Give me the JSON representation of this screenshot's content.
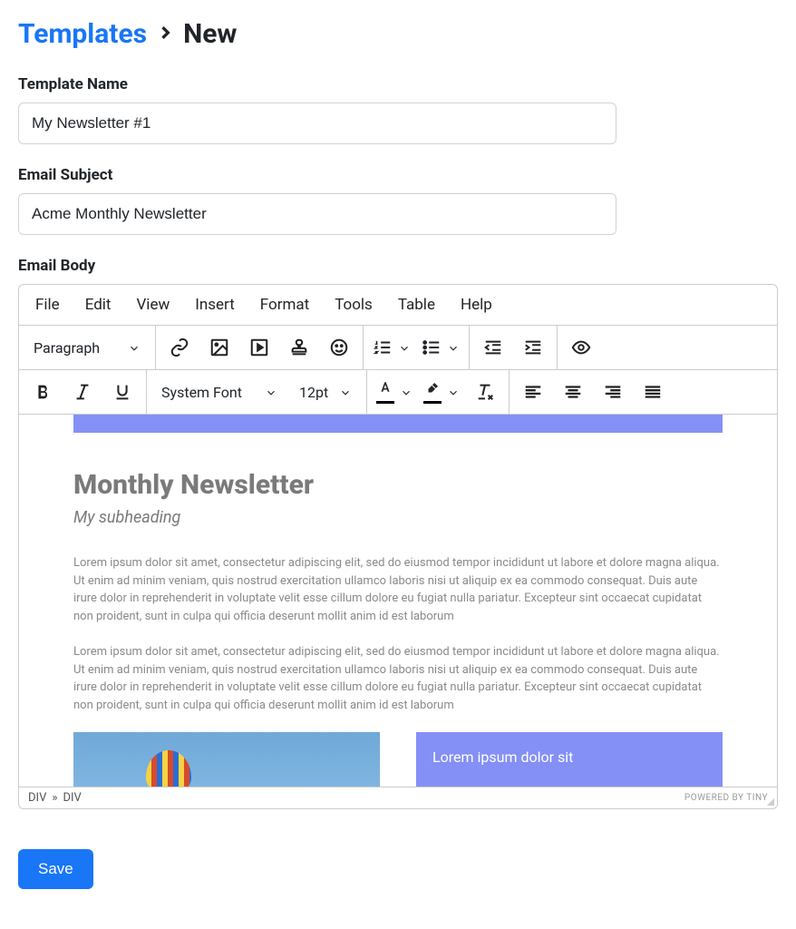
{
  "breadcrumb": {
    "root": "Templates",
    "current": "New"
  },
  "form": {
    "template_name_label": "Template Name",
    "template_name_value": "My Newsletter #1",
    "email_subject_label": "Email Subject",
    "email_subject_value": "Acme Monthly Newsletter",
    "email_body_label": "Email Body"
  },
  "editor": {
    "menus": [
      "File",
      "Edit",
      "View",
      "Insert",
      "Format",
      "Tools",
      "Table",
      "Help"
    ],
    "block_format": "Paragraph",
    "font_family": "System Font",
    "font_size": "12pt",
    "statusbar_path": [
      "DIV",
      "DIV"
    ],
    "branding": "POWERED BY TINY"
  },
  "content": {
    "title": "Monthly Newsletter",
    "subtitle": "My subheading",
    "para1": "Lorem ipsum dolor sit amet, consectetur adipiscing elit, sed do eiusmod tempor incididunt ut labore et dolore magna aliqua. Ut enim ad minim veniam, quis nostrud exercitation ullamco laboris nisi ut aliquip ex ea commodo consequat. Duis aute irure dolor in reprehenderit in voluptate velit esse cillum dolore eu fugiat nulla pariatur. Excepteur sint occaecat cupidatat non proident, sunt in culpa qui officia deserunt mollit anim id est laborum",
    "para2": "Lorem ipsum dolor sit amet, consectetur adipiscing elit, sed do eiusmod tempor incididunt ut labore et dolore magna aliqua. Ut enim ad minim veniam, quis nostrud exercitation ullamco laboris nisi ut aliquip ex ea commodo consequat. Duis aute irure dolor in reprehenderit in voluptate velit esse cillum dolore eu fugiat nulla pariatur. Excepteur sint occaecat cupidatat non proident, sunt in culpa qui officia deserunt mollit anim id est laborum",
    "box_text": "Lorem ipsum dolor sit"
  },
  "buttons": {
    "save": "Save"
  }
}
